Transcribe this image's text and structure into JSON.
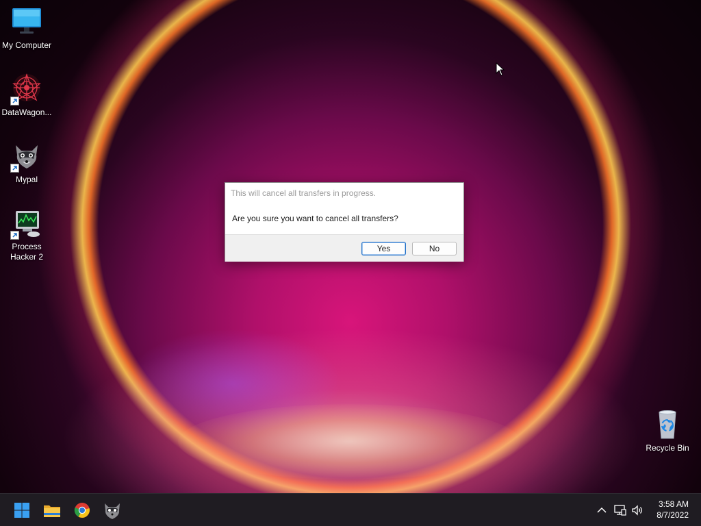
{
  "desktop": {
    "icons": [
      {
        "label": "My Computer",
        "icon": "monitor-icon",
        "shortcut": false
      },
      {
        "label": "DataWagon...",
        "icon": "datawagon-app-icon",
        "shortcut": true
      },
      {
        "label": "Mypal",
        "icon": "raccoon-browser-icon",
        "shortcut": true
      },
      {
        "label": "Process\nHacker 2",
        "label_line1": "Process",
        "label_line2": "Hacker 2",
        "icon": "process-hacker-icon",
        "shortcut": true
      },
      {
        "label": "Recycle Bin",
        "icon": "recycle-bin-icon",
        "shortcut": false
      }
    ]
  },
  "dialog": {
    "title": "This will cancel all transfers in progress.",
    "message": "Are you sure you want to cancel all transfers?",
    "yes_label": "Yes",
    "no_label": "No",
    "default_button": "Yes"
  },
  "taskbar": {
    "pinned": [
      {
        "name": "start-button",
        "icon": "windows-logo-icon"
      },
      {
        "name": "file-explorer",
        "icon": "folder-icon"
      },
      {
        "name": "chrome",
        "icon": "chrome-icon"
      },
      {
        "name": "mypal",
        "icon": "raccoon-browser-icon"
      }
    ],
    "tray": {
      "icons": [
        "chevron-up-icon",
        "network-icon",
        "volume-icon"
      ]
    },
    "clock": {
      "time": "3:58 AM",
      "date": "8/7/2022"
    }
  },
  "colors": {
    "accent": "#1f6fc6",
    "taskbar": "#1f1c22",
    "wallpaper_core": "#d8157a"
  }
}
